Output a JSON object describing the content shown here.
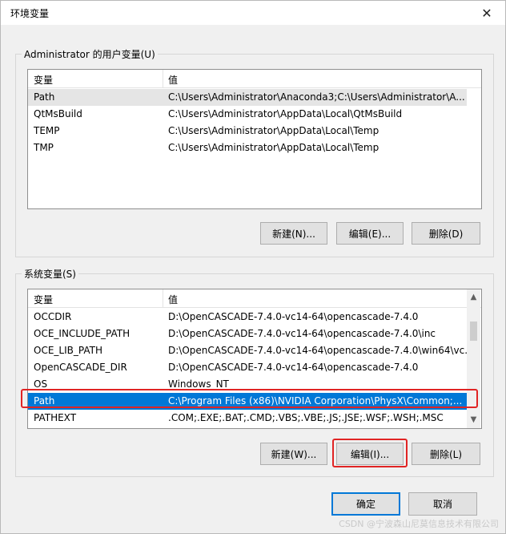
{
  "window": {
    "title": "环境变量",
    "close_glyph": "✕"
  },
  "user_group": {
    "legend": "Administrator 的用户变量(U)",
    "columns": [
      "变量",
      "值"
    ],
    "rows": [
      [
        "Path",
        "C:\\Users\\Administrator\\Anaconda3;C:\\Users\\Administrator\\A..."
      ],
      [
        "QtMsBuild",
        "C:\\Users\\Administrator\\AppData\\Local\\QtMsBuild"
      ],
      [
        "TEMP",
        "C:\\Users\\Administrator\\AppData\\Local\\Temp"
      ],
      [
        "TMP",
        "C:\\Users\\Administrator\\AppData\\Local\\Temp"
      ]
    ],
    "buttons": {
      "new": "新建(N)...",
      "edit": "编辑(E)...",
      "delete": "删除(D)"
    }
  },
  "system_group": {
    "legend": "系统变量(S)",
    "columns": [
      "变量",
      "值"
    ],
    "rows": [
      [
        "OCCDIR",
        "D:\\OpenCASCADE-7.4.0-vc14-64\\opencascade-7.4.0"
      ],
      [
        "OCE_INCLUDE_PATH",
        "D:\\OpenCASCADE-7.4.0-vc14-64\\opencascade-7.4.0\\inc"
      ],
      [
        "OCE_LIB_PATH",
        "D:\\OpenCASCADE-7.4.0-vc14-64\\opencascade-7.4.0\\win64\\vc..."
      ],
      [
        "OpenCASCADE_DIR",
        "D:\\OpenCASCADE-7.4.0-vc14-64\\opencascade-7.4.0"
      ],
      [
        "OS",
        "Windows_NT"
      ],
      [
        "Path",
        "C:\\Program Files (x86)\\NVIDIA Corporation\\PhysX\\Common;..."
      ],
      [
        "PATHEXT",
        ".COM;.EXE;.BAT;.CMD;.VBS;.VBE;.JS;.JSE;.WSF;.WSH;.MSC"
      ]
    ],
    "buttons": {
      "new": "新建(W)...",
      "edit": "编辑(I)...",
      "delete": "删除(L)"
    }
  },
  "footer": {
    "ok": "确定",
    "cancel": "取消"
  },
  "watermark": "CSDN @宁波森山尼莫信息技术有限公司",
  "colors": {
    "selection": "#0078d7",
    "highlight_box": "#e02424"
  }
}
